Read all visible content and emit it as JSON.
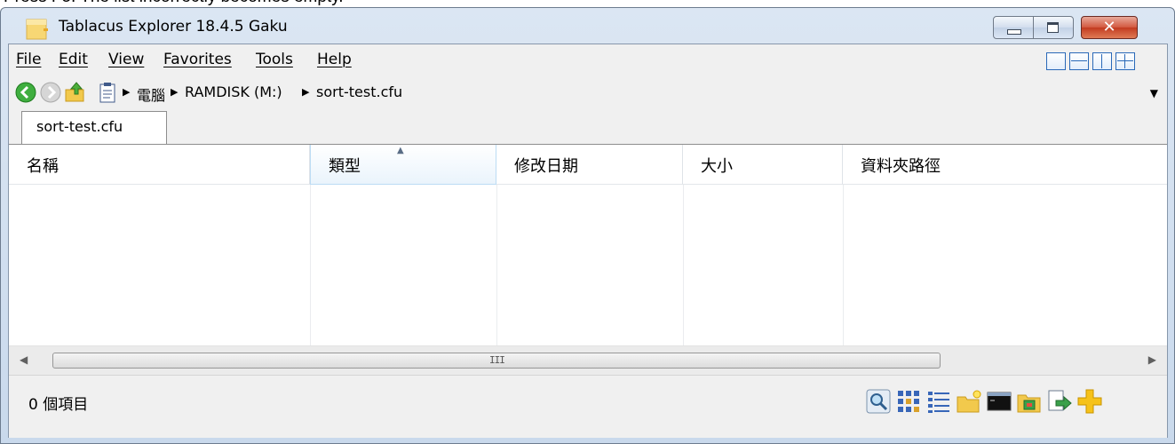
{
  "caption": "Press F5. The list incorrectly becomes empty.",
  "window": {
    "title": "Tablacus Explorer 18.4.5 Gaku",
    "close_glyph": "✕"
  },
  "menu": {
    "items": [
      {
        "label": "File",
        "name": "file"
      },
      {
        "label": "Edit",
        "name": "edit"
      },
      {
        "label": "View",
        "name": "view"
      },
      {
        "label": "Favorites",
        "name": "favorites"
      },
      {
        "label": "Tools",
        "name": "tools"
      },
      {
        "label": "Help",
        "name": "help"
      }
    ]
  },
  "address": {
    "crumbs": [
      "電腦",
      "RAMDISK (M:)",
      "sort-test.cfu"
    ],
    "separator": "▶",
    "dropdown": "▼"
  },
  "tabs": [
    {
      "label": "sort-test.cfu",
      "active": true
    }
  ],
  "columns": [
    {
      "label": "名稱",
      "sorted": false
    },
    {
      "label": "類型",
      "sorted": true,
      "sort_direction": "ascending",
      "sort_glyph": "▲"
    },
    {
      "label": "修改日期",
      "sorted": false
    },
    {
      "label": "大小",
      "sorted": false
    },
    {
      "label": "資料夾路徑",
      "sorted": false
    }
  ],
  "rows": [],
  "scrollbar": {
    "left_arrow": "◀",
    "right_arrow": "▶",
    "grip": "III"
  },
  "status": {
    "text": "0 個項目"
  },
  "colors": {
    "accent": "#2a69b8",
    "sorted_header_border": "#bcdcf4",
    "close_button": "#c23b20"
  }
}
